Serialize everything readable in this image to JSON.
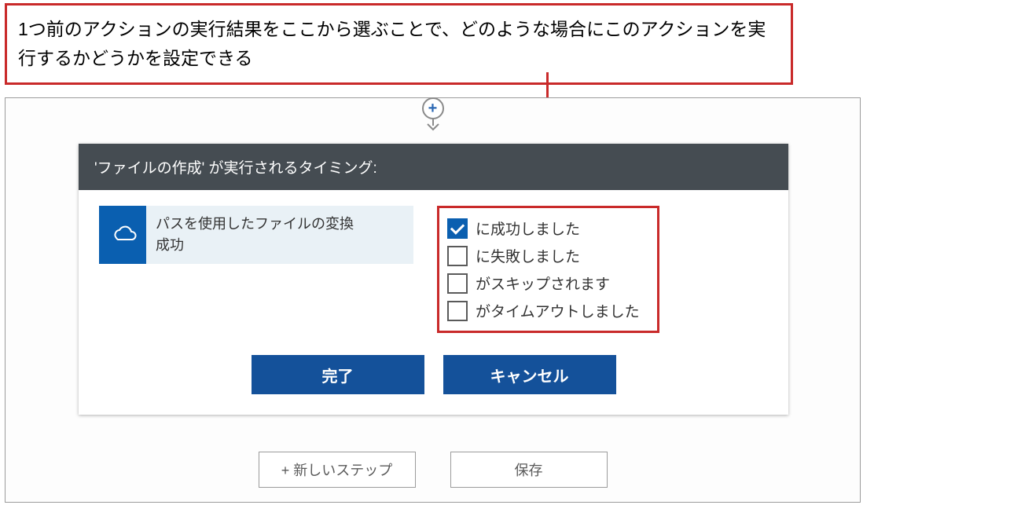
{
  "annotation": {
    "text": "1つ前のアクションの実行結果をここから選ぶことで、どのような場合にこのアクションを実行するかどうかを設定できる"
  },
  "panel": {
    "header": "'ファイルの作成' が実行されるタイミング:",
    "action": {
      "icon_name": "onedrive-icon",
      "title": "パスを使用したファイルの変換",
      "status": "成功"
    },
    "options": [
      {
        "label": "に成功しました",
        "checked": true
      },
      {
        "label": "に失敗しました",
        "checked": false
      },
      {
        "label": "がスキップされます",
        "checked": false
      },
      {
        "label": "がタイムアウトしました",
        "checked": false
      }
    ],
    "buttons": {
      "done": "完了",
      "cancel": "キャンセル"
    }
  },
  "footer": {
    "new_step": "+ 新しいステップ",
    "save": "保存"
  },
  "add_node": {
    "plus": "+"
  }
}
